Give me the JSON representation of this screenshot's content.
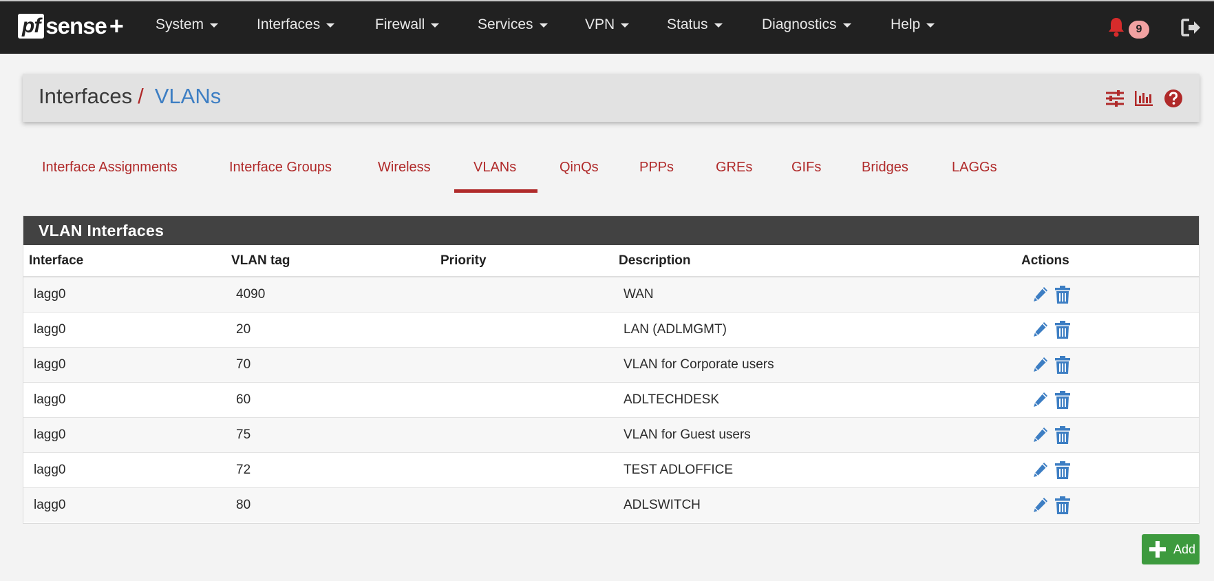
{
  "brand": {
    "pf": "pf",
    "sense": "sense",
    "plus": "+"
  },
  "nav": {
    "items": [
      "System",
      "Interfaces",
      "Firewall",
      "Services",
      "VPN",
      "Status",
      "Diagnostics",
      "Help"
    ],
    "notification_count": "9"
  },
  "header": {
    "crumb_parent": "Interfaces",
    "crumb_separator": "/",
    "crumb_current": "VLANs"
  },
  "tabs": {
    "items": [
      "Interface Assignments",
      "Interface Groups",
      "Wireless",
      "VLANs",
      "QinQs",
      "PPPs",
      "GREs",
      "GIFs",
      "Bridges",
      "LAGGs"
    ],
    "active": "VLANs"
  },
  "panel": {
    "title": "VLAN Interfaces",
    "columns": [
      "Interface",
      "VLAN tag",
      "Priority",
      "Description",
      "Actions"
    ],
    "rows": [
      {
        "interface": "lagg0",
        "tag": "4090",
        "priority": "",
        "description": "WAN"
      },
      {
        "interface": "lagg0",
        "tag": "20",
        "priority": "",
        "description": "LAN (ADLMGMT)"
      },
      {
        "interface": "lagg0",
        "tag": "70",
        "priority": "",
        "description": "VLAN for Corporate users"
      },
      {
        "interface": "lagg0",
        "tag": "60",
        "priority": "",
        "description": "ADLTECHDESK"
      },
      {
        "interface": "lagg0",
        "tag": "75",
        "priority": "",
        "description": "VLAN for Guest users"
      },
      {
        "interface": "lagg0",
        "tag": "72",
        "priority": "",
        "description": "TEST ADLOFFICE"
      },
      {
        "interface": "lagg0",
        "tag": "80",
        "priority": "",
        "description": "ADLSWITCH"
      }
    ]
  },
  "add_button": {
    "label": "Add"
  },
  "colors": {
    "navbar": "#212121",
    "accent_red": "#b02a2a",
    "link_blue": "#3d7ec3",
    "panel_heading": "#424242",
    "add_green": "#3d9a3e",
    "icon_blue": "#3d7ec3"
  },
  "icons": {
    "nav_right": [
      "bell-icon",
      "logout-icon"
    ],
    "header": [
      "sliders-icon",
      "bar-chart-icon",
      "help-icon"
    ],
    "row_actions": [
      "pencil-icon",
      "trash-icon"
    ],
    "add": "plus-icon"
  }
}
